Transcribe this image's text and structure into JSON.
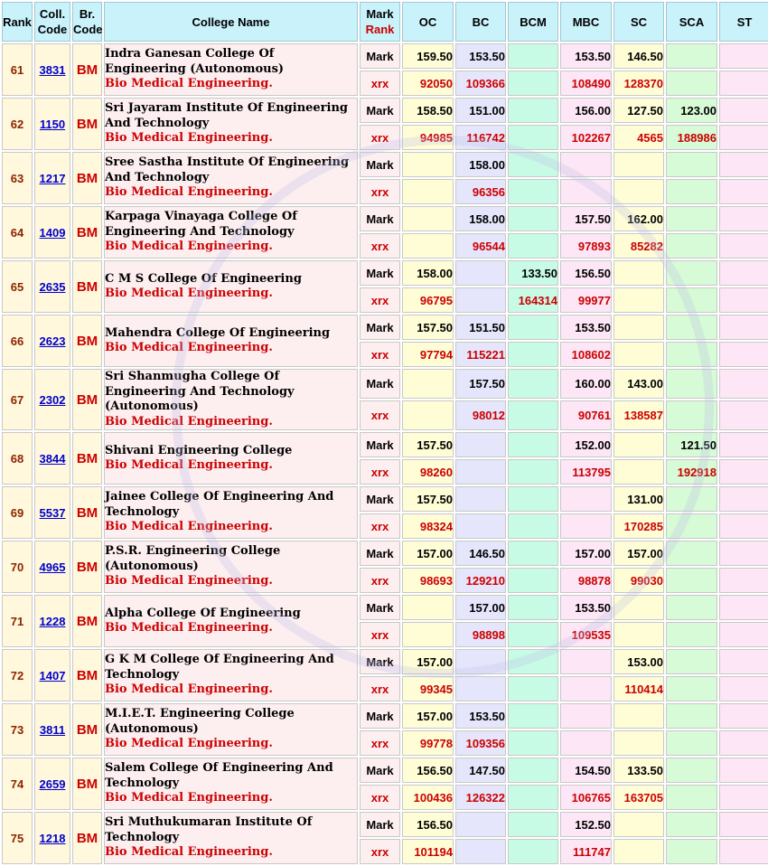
{
  "header": {
    "rank": "Rank",
    "coll_code_1": "Coll.",
    "coll_code_2": "Code",
    "br_code_1": "Br.",
    "br_code_2": "Code",
    "college_name": "College Name",
    "mark_rank_1": "Mark",
    "mark_rank_2": "Rank",
    "categories": [
      "OC",
      "BC",
      "BCM",
      "MBC",
      "SC",
      "SCA",
      "ST"
    ]
  },
  "labels": {
    "mark": "Mark",
    "rank": "xrx"
  },
  "rows": [
    {
      "rank": "61",
      "code": "3831",
      "branch": "BM",
      "college": "Indra Ganesan College Of Engineering (Autonomous)",
      "branch_name": "Bio Medical Engineering.",
      "marks": [
        "159.50",
        "153.50",
        "",
        "153.50",
        "146.50",
        "",
        ""
      ],
      "ranks": [
        "92050",
        "109366",
        "",
        "108490",
        "128370",
        "",
        ""
      ]
    },
    {
      "rank": "62",
      "code": "1150",
      "branch": "BM",
      "college": "Sri Jayaram Institute Of Engineering And Technology",
      "branch_name": "Bio Medical Engineering.",
      "marks": [
        "158.50",
        "151.00",
        "",
        "156.00",
        "127.50",
        "123.00",
        ""
      ],
      "ranks": [
        "94985",
        "116742",
        "",
        "102267",
        "4565",
        "188986",
        ""
      ]
    },
    {
      "rank": "63",
      "code": "1217",
      "branch": "BM",
      "college": "Sree Sastha Institute Of Engineering And Technology",
      "branch_name": "Bio Medical Engineering.",
      "marks": [
        "",
        "158.00",
        "",
        "",
        "",
        "",
        ""
      ],
      "ranks": [
        "",
        "96356",
        "",
        "",
        "",
        "",
        ""
      ]
    },
    {
      "rank": "64",
      "code": "1409",
      "branch": "BM",
      "college": "Karpaga Vinayaga College Of Engineering And Technology",
      "branch_name": "Bio Medical Engineering.",
      "marks": [
        "",
        "158.00",
        "",
        "157.50",
        "162.00",
        "",
        ""
      ],
      "ranks": [
        "",
        "96544",
        "",
        "97893",
        "85282",
        "",
        ""
      ]
    },
    {
      "rank": "65",
      "code": "2635",
      "branch": "BM",
      "college": "C M S College Of Engineering",
      "branch_name": "Bio Medical Engineering.",
      "marks": [
        "158.00",
        "",
        "133.50",
        "156.50",
        "",
        "",
        ""
      ],
      "ranks": [
        "96795",
        "",
        "164314",
        "99977",
        "",
        "",
        ""
      ]
    },
    {
      "rank": "66",
      "code": "2623",
      "branch": "BM",
      "college": "Mahendra College Of Engineering",
      "branch_name": "Bio Medical Engineering.",
      "marks": [
        "157.50",
        "151.50",
        "",
        "153.50",
        "",
        "",
        ""
      ],
      "ranks": [
        "97794",
        "115221",
        "",
        "108602",
        "",
        "",
        ""
      ]
    },
    {
      "rank": "67",
      "code": "2302",
      "branch": "BM",
      "college": "Sri Shanmugha College Of Engineering And Technology (Autonomous)",
      "branch_name": "Bio Medical Engineering.",
      "marks": [
        "",
        "157.50",
        "",
        "160.00",
        "143.00",
        "",
        ""
      ],
      "ranks": [
        "",
        "98012",
        "",
        "90761",
        "138587",
        "",
        ""
      ]
    },
    {
      "rank": "68",
      "code": "3844",
      "branch": "BM",
      "college": "Shivani Engineering College",
      "branch_name": "Bio Medical Engineering.",
      "marks": [
        "157.50",
        "",
        "",
        "152.00",
        "",
        "121.50",
        ""
      ],
      "ranks": [
        "98260",
        "",
        "",
        "113795",
        "",
        "192918",
        ""
      ]
    },
    {
      "rank": "69",
      "code": "5537",
      "branch": "BM",
      "college": "Jainee College Of Engineering And Technology",
      "branch_name": "Bio Medical Engineering.",
      "marks": [
        "157.50",
        "",
        "",
        "",
        "131.00",
        "",
        ""
      ],
      "ranks": [
        "98324",
        "",
        "",
        "",
        "170285",
        "",
        ""
      ]
    },
    {
      "rank": "70",
      "code": "4965",
      "branch": "BM",
      "college": "P.S.R. Engineering College (Autonomous)",
      "branch_name": "Bio Medical Engineering.",
      "marks": [
        "157.00",
        "146.50",
        "",
        "157.00",
        "157.00",
        "",
        ""
      ],
      "ranks": [
        "98693",
        "129210",
        "",
        "98878",
        "99030",
        "",
        ""
      ]
    },
    {
      "rank": "71",
      "code": "1228",
      "branch": "BM",
      "college": "Alpha College Of Engineering",
      "branch_name": "Bio Medical Engineering.",
      "marks": [
        "",
        "157.00",
        "",
        "153.50",
        "",
        "",
        ""
      ],
      "ranks": [
        "",
        "98898",
        "",
        "109535",
        "",
        "",
        ""
      ]
    },
    {
      "rank": "72",
      "code": "1407",
      "branch": "BM",
      "college": "G K M College Of Engineering And Technology",
      "branch_name": "Bio Medical Engineering.",
      "marks": [
        "157.00",
        "",
        "",
        "",
        "153.00",
        "",
        ""
      ],
      "ranks": [
        "99345",
        "",
        "",
        "",
        "110414",
        "",
        ""
      ]
    },
    {
      "rank": "73",
      "code": "3811",
      "branch": "BM",
      "college": "M.I.E.T. Engineering College (Autonomous)",
      "branch_name": "Bio Medical Engineering.",
      "marks": [
        "157.00",
        "153.50",
        "",
        "",
        "",
        "",
        ""
      ],
      "ranks": [
        "99778",
        "109356",
        "",
        "",
        "",
        "",
        ""
      ]
    },
    {
      "rank": "74",
      "code": "2659",
      "branch": "BM",
      "college": "Salem College Of Engineering And Technology",
      "branch_name": "Bio Medical Engineering.",
      "marks": [
        "156.50",
        "147.50",
        "",
        "154.50",
        "133.50",
        "",
        ""
      ],
      "ranks": [
        "100436",
        "126322",
        "",
        "106765",
        "163705",
        "",
        ""
      ]
    },
    {
      "rank": "75",
      "code": "1218",
      "branch": "BM",
      "college": "Sri Muthukumaran Institute Of Technology",
      "branch_name": "Bio Medical Engineering.",
      "marks": [
        "156.50",
        "",
        "",
        "152.50",
        "",
        "",
        ""
      ],
      "ranks": [
        "101194",
        "",
        "",
        "111747",
        "",
        "",
        ""
      ]
    }
  ]
}
